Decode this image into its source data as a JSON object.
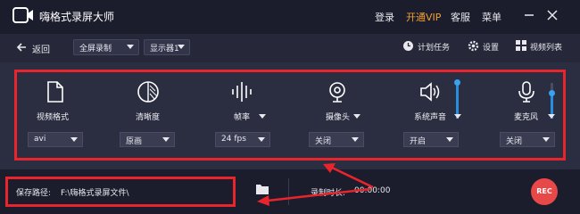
{
  "app": {
    "title": "嗨格式录屏大师"
  },
  "titlebar": {
    "login": "登录",
    "vip": "开通VIP",
    "service": "客服",
    "menu": "菜单"
  },
  "toolbar": {
    "back_label": "返回",
    "mode_select": "全屏录制",
    "display_select": "显示器1",
    "schedule_label": "计划任务",
    "settings_label": "设置",
    "videolist_label": "视频列表"
  },
  "settings": {
    "format": {
      "label": "视频格式",
      "value": "avi",
      "icon": "file-icon"
    },
    "quality": {
      "label": "清晰度",
      "value": "原画",
      "icon": "quality-circle-icon"
    },
    "framerate": {
      "label": "帧率",
      "value": "24 fps",
      "icon": "waveform-icon"
    },
    "camera": {
      "label": "摄像头",
      "value": "关闭",
      "icon": "webcam-icon"
    },
    "system_audio": {
      "label": "系统声音",
      "value": "开启",
      "icon": "speaker-icon",
      "volume_pct": 100
    },
    "microphone": {
      "label": "麦克风",
      "value": "关闭",
      "icon": "microphone-icon",
      "volume_pct": 75
    }
  },
  "bottom": {
    "path_label": "保存路径:",
    "path_value": "F:\\嗨格式录屏文件\\",
    "duration_label": "录制时长:",
    "duration_value": "00:00:00",
    "rec_label": "REC"
  },
  "colors": {
    "accent": "#e8242c",
    "vip": "#f0a030",
    "slider": "#2a8ee0",
    "rec": "#e84848"
  }
}
